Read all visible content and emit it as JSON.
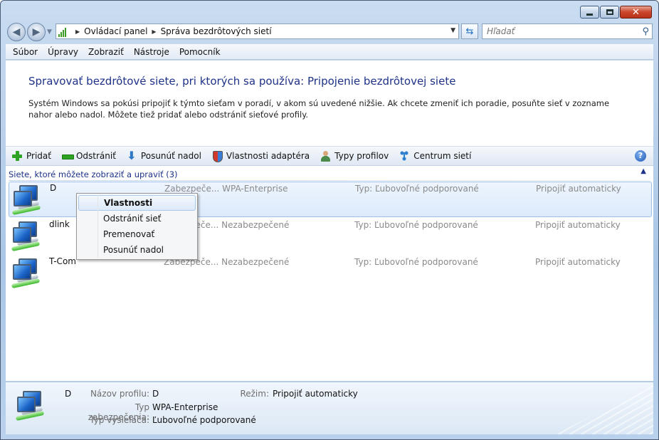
{
  "address": {
    "crumbs": [
      "Ovládací panel",
      "Správa bezdrôtových sietí"
    ]
  },
  "search": {
    "placeholder": "Hľadať"
  },
  "menu": [
    "Súbor",
    "Úpravy",
    "Zobraziť",
    "Nástroje",
    "Pomocník"
  ],
  "page": {
    "heading": "Spravovať bezdrôtové siete, pri ktorých sa používa: Pripojenie bezdrôtovej siete",
    "description": "Systém Windows sa pokúsi pripojiť k týmto sieťam v poradí, v akom sú uvedené nižšie. Ak chcete zmeniť ich poradie, posuňte sieť v zozname nahor alebo nadol. Môžete tiež pridať alebo odstrániť sieťové profily."
  },
  "toolbar": {
    "add": "Pridať",
    "remove": "Odstrániť",
    "move_down": "Posunúť nadol",
    "adapter_props": "Vlastnosti adaptéra",
    "profile_types": "Typy profilov",
    "network_center": "Centrum sietí",
    "help": "?"
  },
  "group": {
    "label": "Siete, ktoré môžete zobraziť a upraviť (3)"
  },
  "networks": [
    {
      "name": "D",
      "security": "Zabezpeče... WPA-Enterprise",
      "type": "Typ: Ľubovoľné podporované",
      "mode": "Pripojiť automaticky"
    },
    {
      "name": "dlink",
      "security": "Zabezpeče... Nezabezpečené",
      "type": "Typ: Ľubovoľné podporované",
      "mode": "Pripojiť automaticky"
    },
    {
      "name": "T-Com",
      "security": "Zabezpeče... Nezabezpečené",
      "type": "Typ: Ľubovoľné podporované",
      "mode": "Pripojiť automaticky"
    }
  ],
  "context_menu": [
    "Vlastnosti",
    "Odstrániť sieť",
    "Premenovať",
    "Posunúť nadol"
  ],
  "details": {
    "name": "D",
    "profile_label": "Názov profilu:",
    "profile_value": "D",
    "security_label": "Typ zabezpečenia:",
    "security_value": "WPA-Enterprise",
    "radio_label": "Typ vysielača:",
    "radio_value": "Ľubovoľné podporované",
    "mode_label": "Režim:",
    "mode_value": "Pripojiť automaticky"
  }
}
